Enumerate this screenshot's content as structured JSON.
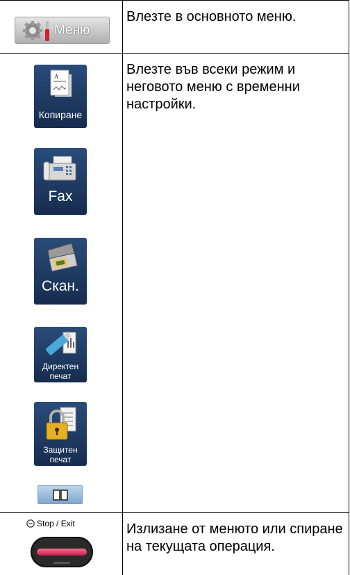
{
  "menu_row": {
    "button_label": "Меню",
    "description": "Влезте в основното меню."
  },
  "modes_row": {
    "description": "Влезте във всеки режим и неговото меню с временни настройки.",
    "modes": {
      "copy": "Копиране",
      "fax": "Fax",
      "scan": "Скан.",
      "direct_print": [
        "Директен",
        "печат"
      ],
      "secure_print": [
        "Защитен",
        "печат"
      ]
    }
  },
  "stop_row": {
    "button_label": "Stop / Exit",
    "description": "Излизане от менюто или спиране на текущата операция."
  },
  "colors": {
    "mode_tile": "#1f3c66",
    "stop_bar": "#e0416a",
    "menu_button": "#c8c8c8"
  },
  "icons": [
    "gear-icon",
    "wrench-icon",
    "copy-document-icon",
    "fax-machine-icon",
    "scanner-icon",
    "usb-memory-icon",
    "padlock-icon",
    "book-icon",
    "stop-icon"
  ]
}
